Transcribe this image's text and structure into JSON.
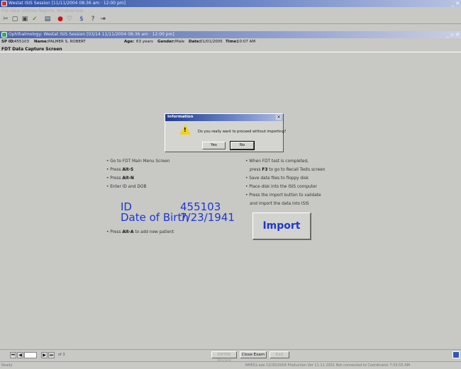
{
  "app": {
    "title": "Westat ISIS Session [11/11/2004 08:36 am · 12:00 pm]",
    "inner_title": "Ophthalmology: Westat ISIS Session [03/14 11/11/2004 08:36 am · 12:00 pm]"
  },
  "menu": [
    "File",
    "View",
    "Utilities",
    "Reports",
    "Window",
    "Help"
  ],
  "patient": {
    "sp_id_label": "SP ID:",
    "sp_id": "455103",
    "name_label": "Name:",
    "name": "PALMER S, ROBERT",
    "age_label": "Age:",
    "age": "63 years",
    "gender_label": "Gender:",
    "gender": "Male",
    "date_label": "Date:",
    "date": "01/01/2005",
    "time_label": "Time:",
    "time": "10:07 AM"
  },
  "screen": {
    "title": "FDT Data Capture Screen"
  },
  "instructions_left": {
    "line1": "Go to FDT Main Menu Screen",
    "line2_pre": "Press ",
    "line2_key": "Alt-S",
    "line3_pre": "Press ",
    "line3_key": "Alt-N",
    "line4": "Enter ID and DOB",
    "line5_pre": "Press ",
    "line5_key": "Alt-A",
    "line5_post": " to add new patient"
  },
  "instructions_right": {
    "line1": "When FDT test is completed,",
    "line2_pre": "press ",
    "line2_key": "F3",
    "line2_post": " to go to Recall Tests screen",
    "line3": "Save data files to floppy disk",
    "line4": "Place disk into the ISIS computer",
    "line5": "Press the import button to validate",
    "line6": "and import the data into ISIS"
  },
  "id_block": {
    "id_label": "ID",
    "id_value": "455103",
    "dob_label": "Date of Birth",
    "dob_value": "7/23/1941"
  },
  "import_button": "Import",
  "dialog": {
    "title": "Information",
    "message": "Do you really want to proceed without importing?",
    "yes": "Yes",
    "no": "No"
  },
  "bottom": {
    "page_label": "of 3",
    "btn_enter_review": "ENTER Review",
    "btn_close_exam": "Close Exam",
    "btn_exit": "Exit"
  },
  "status": {
    "left": "Ready",
    "right": "NHES1.exe 12/30/2004 Production Ver 11.11.2001 Not connected to Coordinator 7:55:55 AM"
  },
  "colors": {
    "accent_blue": "#1c36d8",
    "title_blue": "#2d4fa3",
    "bg": "#c8c8c4"
  }
}
